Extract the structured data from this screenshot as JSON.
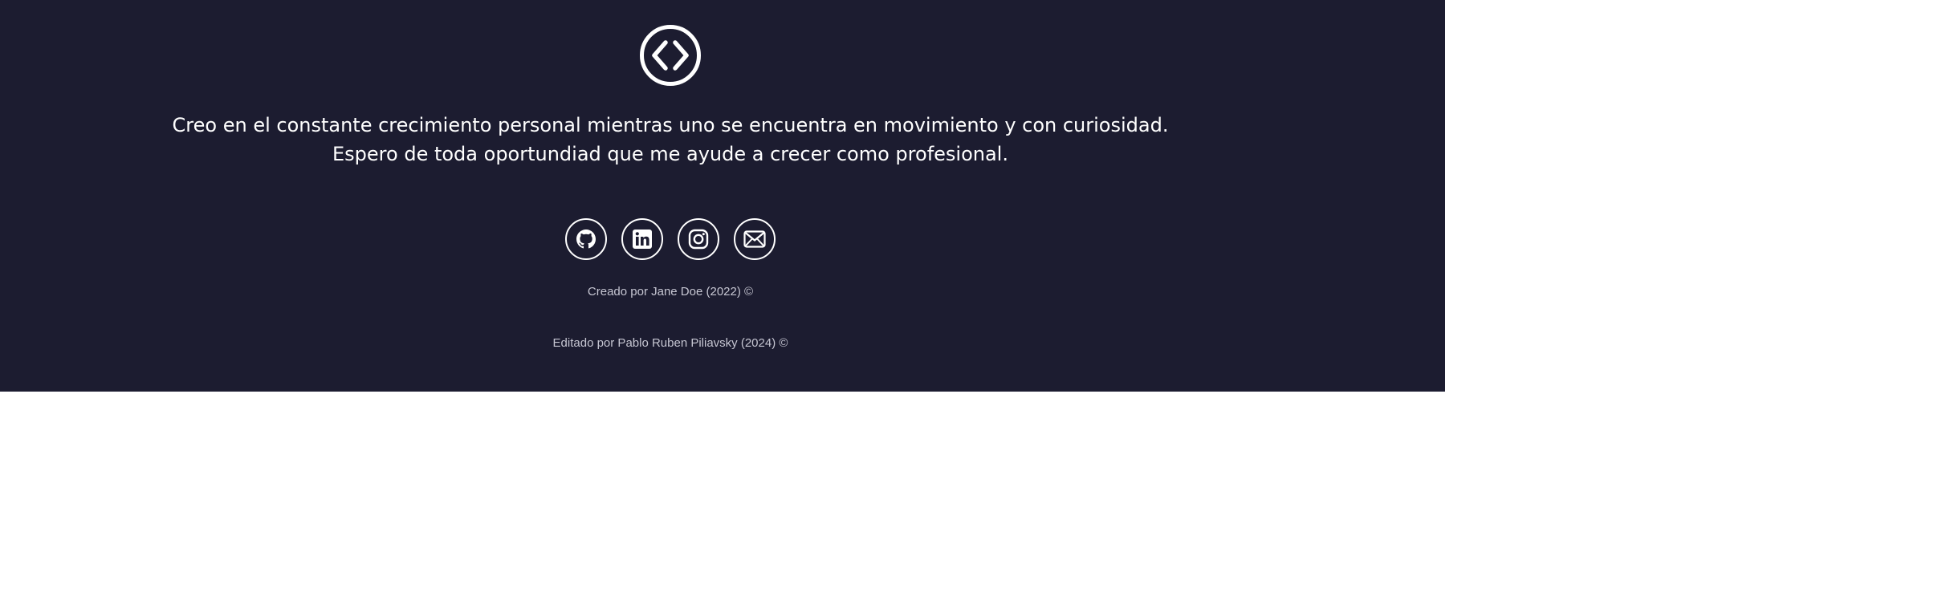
{
  "footer": {
    "logo_icon": "code-brackets-icon",
    "tagline_line1": "Creo en el constante crecimiento personal mientras uno se encuentra en movimiento y con curiosidad.",
    "tagline_line2": "Espero de toda oportundiad que me ayude a crecer como profesional.",
    "social_icons": [
      "github-icon",
      "linkedin-icon",
      "instagram-icon",
      "mail-icon"
    ],
    "created_by": "Creado por Jane Doe (2022) ©",
    "edited_by": "Editado por Pablo Ruben Piliavsky (2024) ©"
  },
  "colors": {
    "background": "#1c1c30",
    "text": "#ffffff",
    "muted_text": "#c6c6d2",
    "page": "#ffffff"
  }
}
